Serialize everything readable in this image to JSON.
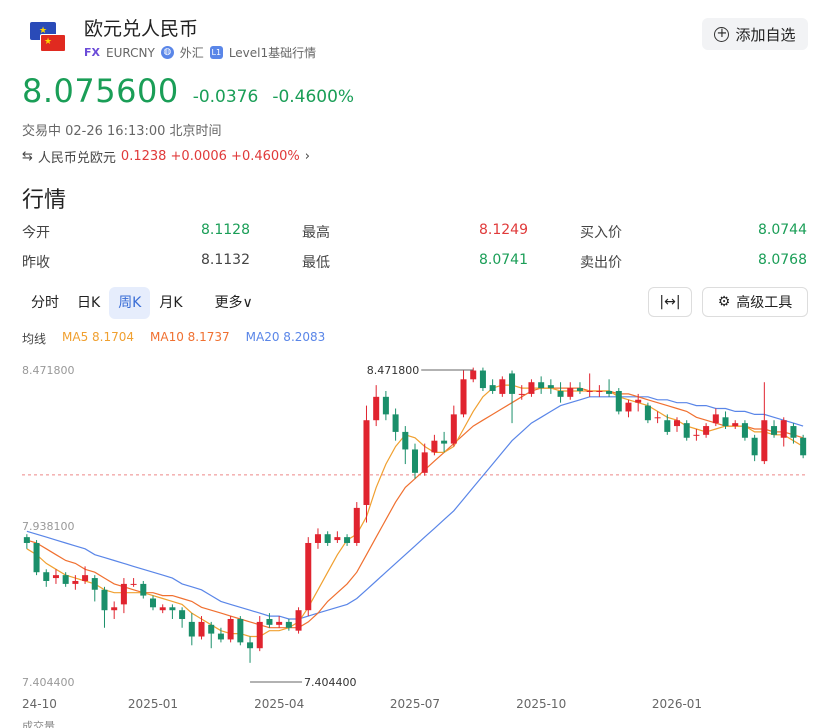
{
  "header": {
    "title": "欧元兑人民币",
    "tag_fx": "FX",
    "symbol": "EURCNY",
    "market": "外汇",
    "level_tag": "L1",
    "level_text": "Level1基础行情",
    "flag_top": "★",
    "flag_bottom": "★",
    "add_button": "添加自选",
    "add_icon": "+"
  },
  "price": {
    "last": "8.075600",
    "change": "-0.0376",
    "change_pct": "-0.4600%",
    "status": "交易中 02-26 16:13:00 北京时间",
    "inverse_icon": "⇆",
    "inverse_label": "人民币兑欧元",
    "inverse_value": "0.1238 +0.0006 +0.4600%",
    "inverse_arrow": "›"
  },
  "section_title": "行情",
  "quote": {
    "open_label": "今开",
    "open_value": "8.1128",
    "high_label": "最高",
    "high_value": "8.1249",
    "bid_label": "买入价",
    "bid_value": "8.0744",
    "prev_label": "昨收",
    "prev_value": "8.1132",
    "low_label": "最低",
    "low_value": "8.0741",
    "ask_label": "卖出价",
    "ask_value": "8.0768"
  },
  "tabs": {
    "t1": "分时",
    "t2": "日K",
    "t3": "周K",
    "t4": "月K",
    "more": "更多∨",
    "expand_icon": "|↔|",
    "advanced": "高级工具"
  },
  "ma": {
    "label": "均线",
    "ma5": "MA5 8.1704",
    "ma10": "MA10 8.1737",
    "ma20": "MA20 8.2083",
    "ma5_color": "#f0a030",
    "ma10_color": "#f07030",
    "ma20_color": "#5a86e8"
  },
  "colors": {
    "up": "#e0242f",
    "down": "#1a8f6a"
  },
  "chart_data": {
    "type": "candlestick",
    "title": "",
    "ylim": [
      7.4044,
      8.4718
    ],
    "y_ticks": [
      "8.471800",
      "7.938100",
      "7.404400"
    ],
    "x_ticks": [
      "24-10",
      "2025-01",
      "2025-04",
      "2025-07",
      "2025-10",
      "2026-01"
    ],
    "max_label": "8.471800",
    "min_label": "7.404400",
    "ref_price": 8.1132,
    "candles": [
      [
        7.9,
        7.88,
        7.91,
        7.86
      ],
      [
        7.88,
        7.78,
        7.89,
        7.77
      ],
      [
        7.78,
        7.75,
        7.79,
        7.73
      ],
      [
        7.76,
        7.77,
        7.79,
        7.74
      ],
      [
        7.77,
        7.74,
        7.78,
        7.73
      ],
      [
        7.74,
        7.75,
        7.77,
        7.72
      ],
      [
        7.75,
        7.77,
        7.8,
        7.74
      ],
      [
        7.76,
        7.72,
        7.77,
        7.68
      ],
      [
        7.72,
        7.65,
        7.73,
        7.59
      ],
      [
        7.65,
        7.66,
        7.68,
        7.62
      ],
      [
        7.67,
        7.74,
        7.76,
        7.64
      ],
      [
        7.74,
        7.74,
        7.76,
        7.73
      ],
      [
        7.74,
        7.7,
        7.75,
        7.69
      ],
      [
        7.69,
        7.66,
        7.7,
        7.65
      ],
      [
        7.65,
        7.66,
        7.67,
        7.64
      ],
      [
        7.66,
        7.65,
        7.67,
        7.62
      ],
      [
        7.65,
        7.62,
        7.66,
        7.59
      ],
      [
        7.61,
        7.56,
        7.64,
        7.53
      ],
      [
        7.56,
        7.61,
        7.63,
        7.55
      ],
      [
        7.6,
        7.57,
        7.61,
        7.52
      ],
      [
        7.57,
        7.55,
        7.59,
        7.54
      ],
      [
        7.55,
        7.62,
        7.63,
        7.54
      ],
      [
        7.62,
        7.54,
        7.63,
        7.53
      ],
      [
        7.54,
        7.52,
        7.56,
        7.47
      ],
      [
        7.52,
        7.61,
        7.63,
        7.51
      ],
      [
        7.62,
        7.6,
        7.64,
        7.59
      ],
      [
        7.6,
        7.61,
        7.63,
        7.59
      ],
      [
        7.61,
        7.59,
        7.62,
        7.58
      ],
      [
        7.58,
        7.65,
        7.66,
        7.57
      ],
      [
        7.65,
        7.88,
        7.9,
        7.63
      ],
      [
        7.88,
        7.91,
        7.93,
        7.86
      ],
      [
        7.91,
        7.88,
        7.92,
        7.87
      ],
      [
        7.89,
        7.9,
        7.92,
        7.88
      ],
      [
        7.9,
        7.88,
        7.91,
        7.87
      ],
      [
        7.88,
        8.0,
        8.02,
        7.87
      ],
      [
        8.01,
        8.3,
        8.35,
        7.95
      ],
      [
        8.3,
        8.38,
        8.42,
        8.28
      ],
      [
        8.38,
        8.32,
        8.4,
        8.3
      ],
      [
        8.32,
        8.26,
        8.34,
        8.23
      ],
      [
        8.26,
        8.2,
        8.28,
        8.15
      ],
      [
        8.2,
        8.12,
        8.22,
        8.1
      ],
      [
        8.12,
        8.19,
        8.22,
        8.11
      ],
      [
        8.19,
        8.23,
        8.25,
        8.18
      ],
      [
        8.23,
        8.22,
        8.26,
        8.19
      ],
      [
        8.22,
        8.32,
        8.35,
        8.21
      ],
      [
        8.32,
        8.44,
        8.47,
        8.31
      ],
      [
        8.44,
        8.47,
        8.48,
        8.43
      ],
      [
        8.47,
        8.41,
        8.48,
        8.4
      ],
      [
        8.42,
        8.4,
        8.44,
        8.39
      ],
      [
        8.39,
        8.44,
        8.45,
        8.38
      ],
      [
        8.46,
        8.39,
        8.47,
        8.29
      ],
      [
        8.39,
        8.39,
        8.42,
        8.37
      ],
      [
        8.39,
        8.43,
        8.44,
        8.38
      ],
      [
        8.43,
        8.41,
        8.45,
        8.39
      ],
      [
        8.42,
        8.41,
        8.44,
        8.39
      ],
      [
        8.4,
        8.38,
        8.43,
        8.36
      ],
      [
        8.38,
        8.41,
        8.43,
        8.37
      ],
      [
        8.41,
        8.4,
        8.43,
        8.39
      ],
      [
        8.4,
        8.4,
        8.46,
        8.38
      ],
      [
        8.4,
        8.4,
        8.42,
        8.38
      ],
      [
        8.4,
        8.39,
        8.44,
        8.38
      ],
      [
        8.4,
        8.33,
        8.41,
        8.32
      ],
      [
        8.33,
        8.36,
        8.37,
        8.31
      ],
      [
        8.36,
        8.37,
        8.39,
        8.33
      ],
      [
        8.35,
        8.3,
        8.36,
        8.29
      ],
      [
        8.31,
        8.31,
        8.33,
        8.29
      ],
      [
        8.3,
        8.26,
        8.32,
        8.25
      ],
      [
        8.28,
        8.3,
        8.31,
        8.26
      ],
      [
        8.29,
        8.24,
        8.3,
        8.23
      ],
      [
        8.25,
        8.25,
        8.27,
        8.23
      ],
      [
        8.25,
        8.28,
        8.29,
        8.24
      ],
      [
        8.29,
        8.32,
        8.34,
        8.28
      ],
      [
        8.31,
        8.28,
        8.33,
        8.27
      ],
      [
        8.28,
        8.29,
        8.3,
        8.27
      ],
      [
        8.29,
        8.24,
        8.3,
        8.23
      ],
      [
        8.24,
        8.18,
        8.25,
        8.16
      ],
      [
        8.16,
        8.3,
        8.43,
        8.15
      ],
      [
        8.28,
        8.25,
        8.3,
        8.24
      ],
      [
        8.24,
        8.3,
        8.31,
        8.21
      ],
      [
        8.28,
        8.24,
        8.29,
        8.22
      ],
      [
        8.24,
        8.18,
        8.25,
        8.17
      ]
    ],
    "ma5": [
      7.86,
      7.84,
      7.81,
      7.79,
      7.77,
      7.76,
      7.75,
      7.74,
      7.72,
      7.71,
      7.71,
      7.71,
      7.71,
      7.7,
      7.69,
      7.68,
      7.67,
      7.64,
      7.62,
      7.6,
      7.58,
      7.57,
      7.57,
      7.56,
      7.56,
      7.58,
      7.58,
      7.59,
      7.61,
      7.66,
      7.72,
      7.78,
      7.84,
      7.89,
      7.91,
      7.97,
      8.07,
      8.15,
      8.21,
      8.25,
      8.24,
      8.21,
      8.19,
      8.19,
      8.21,
      8.27,
      8.33,
      8.38,
      8.41,
      8.42,
      8.42,
      8.41,
      8.41,
      8.41,
      8.41,
      8.4,
      8.4,
      8.4,
      8.4,
      8.4,
      8.4,
      8.38,
      8.37,
      8.36,
      8.35,
      8.33,
      8.31,
      8.3,
      8.28,
      8.27,
      8.26,
      8.27,
      8.28,
      8.28,
      8.28,
      8.26,
      8.26,
      8.25,
      8.25,
      8.23,
      8.21
    ],
    "ma10": [
      7.89,
      7.88,
      7.86,
      7.84,
      7.82,
      7.81,
      7.79,
      7.78,
      7.76,
      7.74,
      7.73,
      7.72,
      7.71,
      7.71,
      7.7,
      7.7,
      7.69,
      7.68,
      7.66,
      7.65,
      7.64,
      7.63,
      7.62,
      7.61,
      7.6,
      7.59,
      7.59,
      7.59,
      7.59,
      7.61,
      7.64,
      7.68,
      7.71,
      7.74,
      7.78,
      7.84,
      7.9,
      7.96,
      8.02,
      8.07,
      8.1,
      8.13,
      8.16,
      8.19,
      8.22,
      8.25,
      8.28,
      8.3,
      8.32,
      8.34,
      8.36,
      8.38,
      8.4,
      8.41,
      8.41,
      8.41,
      8.41,
      8.41,
      8.4,
      8.4,
      8.4,
      8.39,
      8.39,
      8.38,
      8.37,
      8.36,
      8.35,
      8.34,
      8.33,
      8.31,
      8.3,
      8.29,
      8.28,
      8.28,
      8.28,
      8.27,
      8.27,
      8.26,
      8.26,
      8.25,
      8.24
    ],
    "ma20": [
      7.92,
      7.91,
      7.9,
      7.89,
      7.88,
      7.87,
      7.86,
      7.84,
      7.83,
      7.82,
      7.81,
      7.8,
      7.79,
      7.78,
      7.77,
      7.76,
      7.74,
      7.73,
      7.72,
      7.7,
      7.68,
      7.67,
      7.66,
      7.65,
      7.64,
      7.63,
      7.63,
      7.62,
      7.62,
      7.63,
      7.64,
      7.65,
      7.66,
      7.67,
      7.69,
      7.72,
      7.75,
      7.78,
      7.81,
      7.84,
      7.87,
      7.9,
      7.93,
      7.96,
      7.99,
      8.03,
      8.07,
      8.11,
      8.15,
      8.19,
      8.23,
      8.26,
      8.29,
      8.31,
      8.33,
      8.35,
      8.36,
      8.37,
      8.38,
      8.38,
      8.38,
      8.38,
      8.38,
      8.38,
      8.38,
      8.37,
      8.37,
      8.36,
      8.36,
      8.35,
      8.35,
      8.34,
      8.34,
      8.33,
      8.33,
      8.32,
      8.32,
      8.31,
      8.3,
      8.29,
      8.28
    ]
  },
  "footnote": "成交量"
}
